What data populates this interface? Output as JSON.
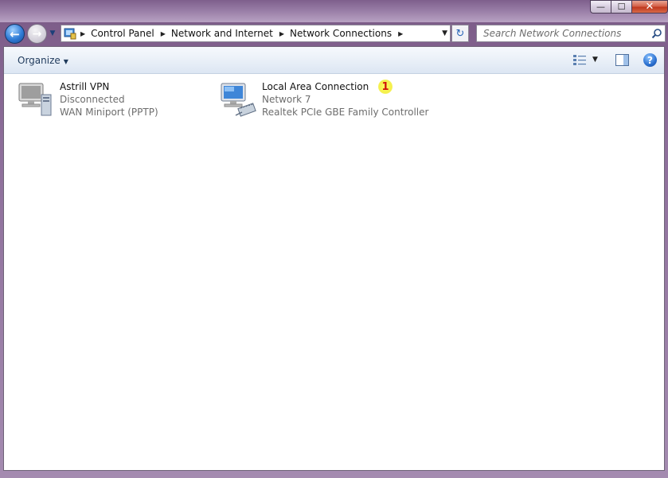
{
  "window": {
    "caption_buttons": {
      "minimize": "—",
      "maximize": "☐",
      "close": "✕"
    }
  },
  "nav": {
    "breadcrumbs": [
      "Control Panel",
      "Network and Internet",
      "Network Connections"
    ],
    "search_placeholder": "Search Network Connections"
  },
  "toolbar": {
    "organize_label": "Organize",
    "help_label": "?"
  },
  "connections": [
    {
      "name": "Astrill VPN",
      "status": "Disconnected",
      "device": "WAN Miniport (PPTP)",
      "icon": "vpn-connection-icon"
    },
    {
      "name": "Local Area Connection",
      "status": "Network  7",
      "device": "Realtek PCIe GBE Family Controller",
      "icon": "lan-connection-icon"
    }
  ],
  "annotation": {
    "marker_label": "1"
  },
  "colors": {
    "accent": "#2f7cd6",
    "marker_bg": "#f4ef4a",
    "marker_text": "#d0120a"
  }
}
